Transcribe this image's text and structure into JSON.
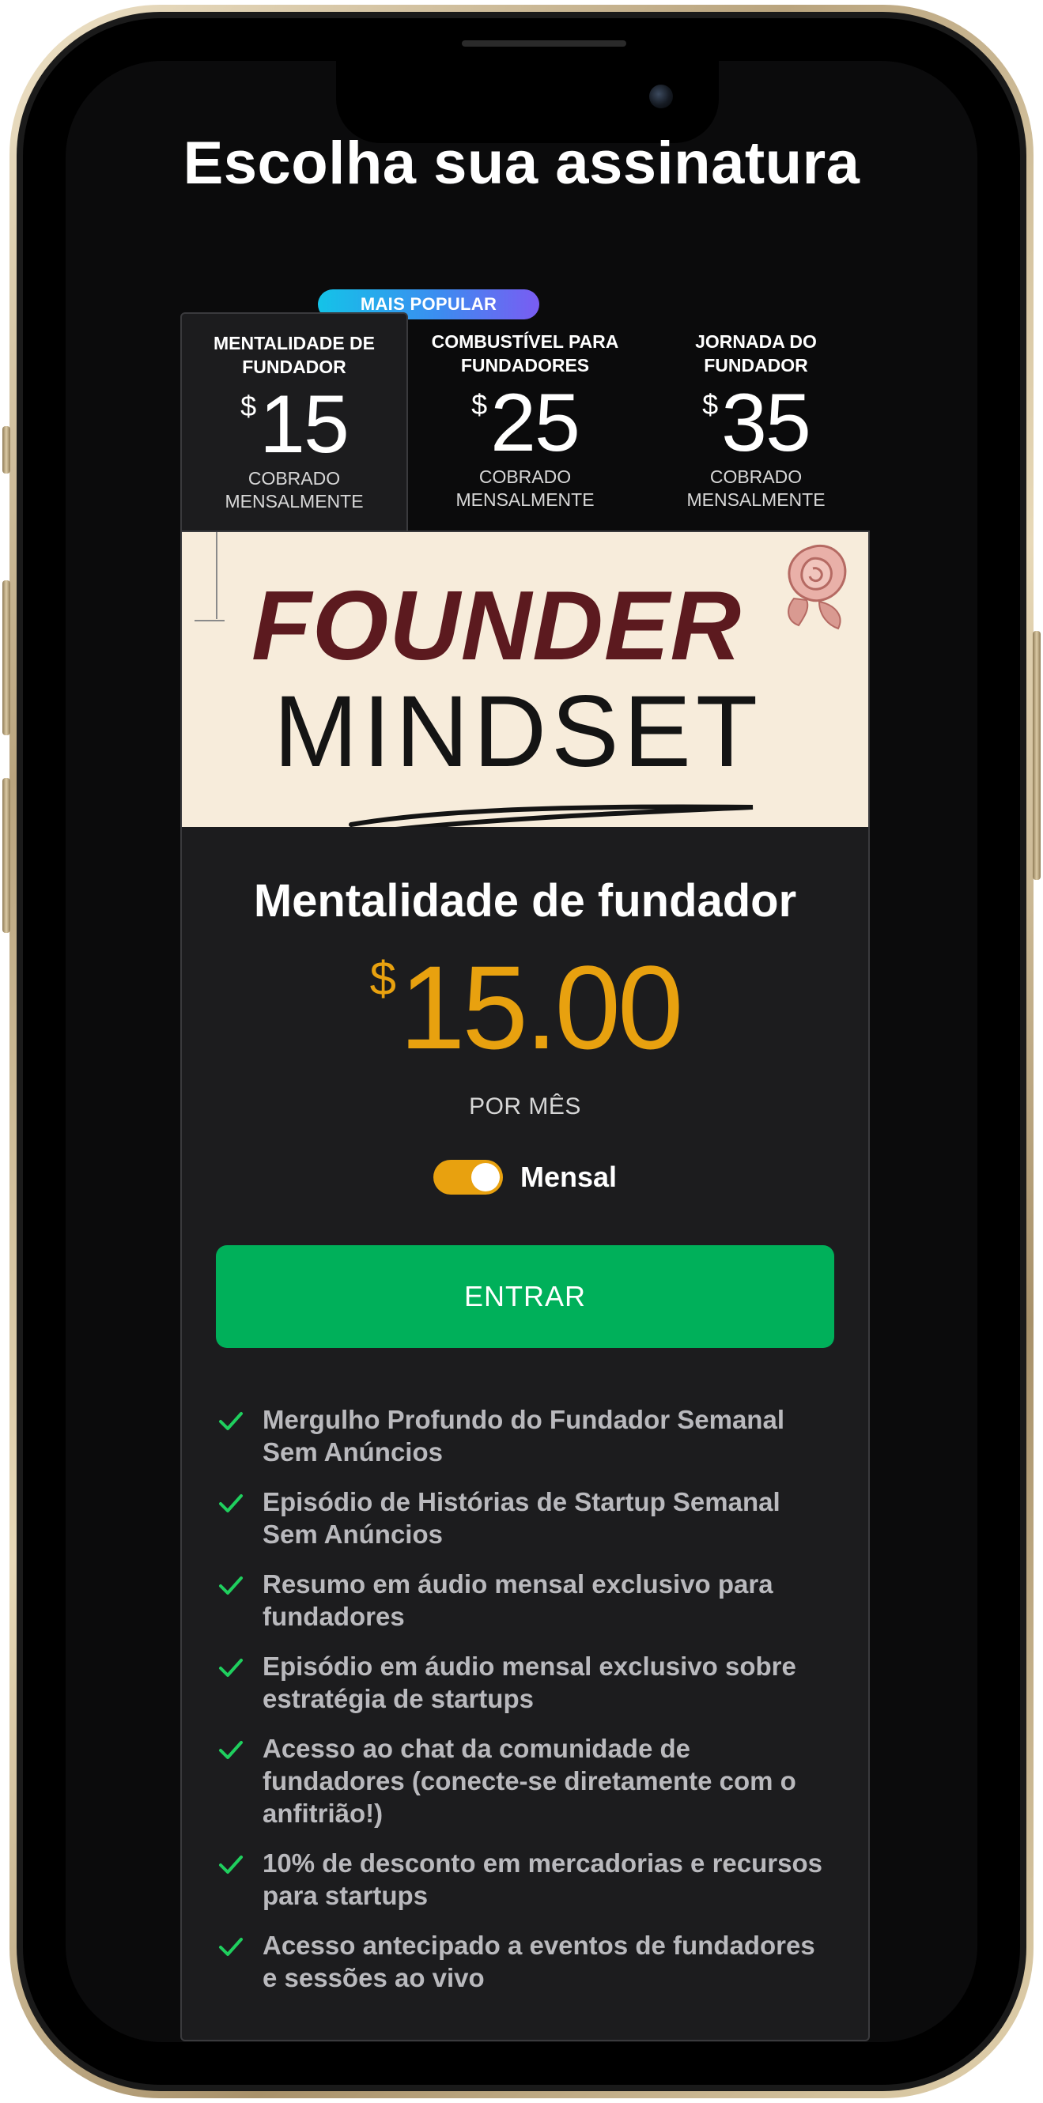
{
  "page": {
    "title": "Escolha sua assinatura"
  },
  "plans": [
    {
      "name": "MENTALIDADE DE FUNDADOR",
      "currency": "$",
      "amount": "15",
      "billing": "COBRADO MENSALMENTE"
    },
    {
      "name": "COMBUSTÍVEL PARA FUNDADORES",
      "currency": "$",
      "amount": "25",
      "billing": "COBRADO MENSALMENTE"
    },
    {
      "name": "JORNADA DO FUNDADOR",
      "currency": "$",
      "amount": "35",
      "billing": "COBRADO MENSALMENTE"
    }
  ],
  "popular_badge": "MAIS POPULAR",
  "selected_plan": {
    "banner": {
      "line1": "FOUNDER",
      "line2": "MINDSET"
    },
    "name": "Mentalidade de fundador",
    "currency": "$",
    "price": "15.00",
    "period": "POR MÊS",
    "toggle_label": "Mensal",
    "toggle_on": true,
    "join_label": "ENTRAR",
    "features": [
      "Mergulho Profundo do Fundador Semanal Sem Anúncios",
      "Episódio de Histórias de Startup Semanal Sem Anúncios",
      "Resumo em áudio mensal exclusivo para fundadores",
      "Episódio em áudio mensal exclusivo sobre estratégia de startups",
      "Acesso ao chat da comunidade de fundadores (conecte-se diretamente com o anfitrião!)",
      "10% de desconto em mercadorias e recursos para startups",
      "Acesso antecipado a eventos de fundadores e sessões ao vivo"
    ]
  },
  "colors": {
    "accent": "#e8a10f",
    "join_button": "#00b05a",
    "check": "#1fcf5e",
    "badge_gradient": [
      "#14c3e8",
      "#7a5cf2"
    ],
    "card_background": "#1c1c1e",
    "banner_title_1": "#5c1a1f"
  },
  "icons": {
    "feature_check": "check-icon"
  }
}
